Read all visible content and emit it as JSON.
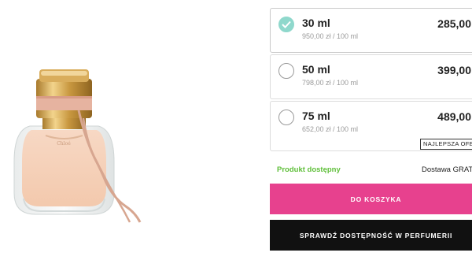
{
  "options": [
    {
      "size": "30 ml",
      "unit_price": "950,00 zł / 100 ml",
      "price": "285,00",
      "selected": true
    },
    {
      "size": "50 ml",
      "unit_price": "798,00 zł / 100 ml",
      "price": "399,00",
      "selected": false
    },
    {
      "size": "75 ml",
      "unit_price": "652,00 zł / 100 ml",
      "price": "489,00",
      "selected": false,
      "badge": "NAJLEPSZA OFE"
    }
  ],
  "availability": "Produkt dostępny",
  "delivery": "Dostawa GRATIS",
  "buttons": {
    "add_to_cart": "DO KOSZYKA",
    "check_store": "SPRAWDŹ DOSTĘPNOŚĆ W PERFUMERII"
  },
  "colors": {
    "accent_pink": "#e7418e",
    "available_green": "#5fbf3a",
    "selected_teal": "#8fd8cc",
    "dark_button": "#111111"
  }
}
